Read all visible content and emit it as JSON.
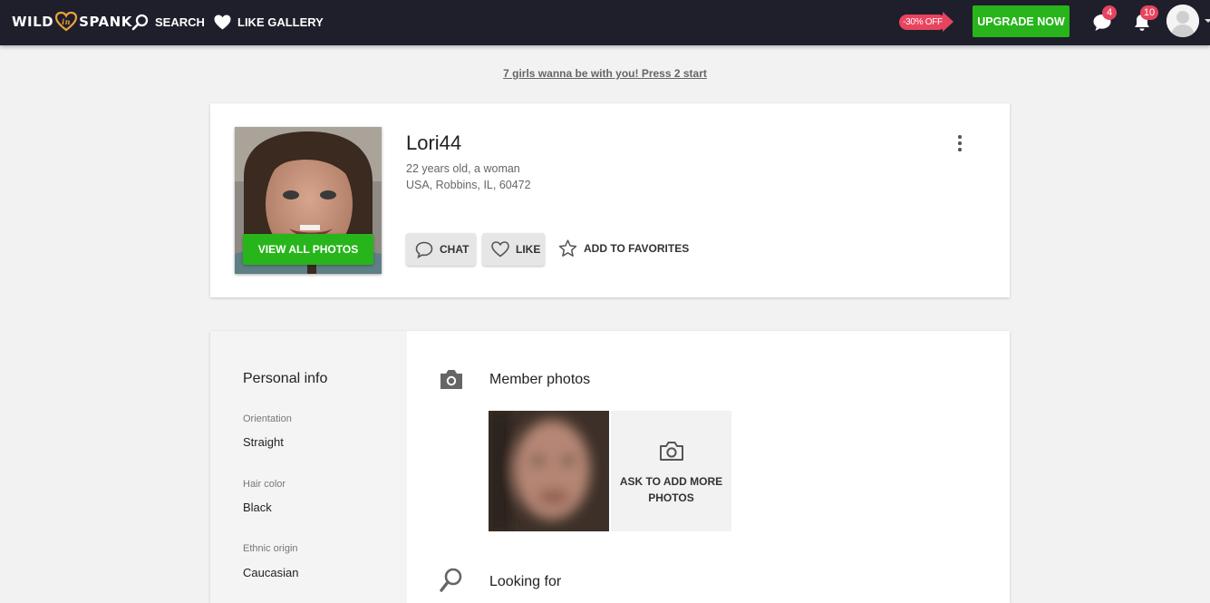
{
  "header": {
    "logo_left": "WILD",
    "logo_right": "SPANK",
    "search_label": "SEARCH",
    "like_gallery_label": "LIKE GALLERY",
    "discount": "-30% OFF",
    "upgrade_label": "UPGRADE NOW",
    "messages_count": "4",
    "notifications_count": "10"
  },
  "promo": {
    "text": "7 girls wanna be with you! Press 2 start"
  },
  "profile": {
    "name": "Lori44",
    "age_gender": "22 years old, a woman",
    "location": "USA, Robbins, IL, 60472",
    "view_photos_label": "VIEW ALL PHOTOS",
    "chat_label": "CHAT",
    "like_label": "LIKE",
    "favorites_label": "ADD TO FAVORITES"
  },
  "personal_info": {
    "title": "Personal info",
    "fields": [
      {
        "label": "Orientation",
        "value": "Straight"
      },
      {
        "label": "Hair color",
        "value": "Black"
      },
      {
        "label": "Ethnic origin",
        "value": "Caucasian"
      }
    ]
  },
  "sections": {
    "photos_title": "Member photos",
    "ask_more_line1": "ASK TO ADD MORE",
    "ask_more_line2": "PHOTOS",
    "looking_for_title": "Looking for"
  },
  "colors": {
    "navbar": "#1f1f2c",
    "accent_green": "#27b51b",
    "badge_red": "#e8445f",
    "page_bg": "#f2f2f2"
  },
  "icons": [
    "search-icon",
    "heart-icon",
    "chat-bubble-icon",
    "bell-icon",
    "user-avatar-icon",
    "kebab-menu-icon",
    "star-icon",
    "camera-icon"
  ]
}
